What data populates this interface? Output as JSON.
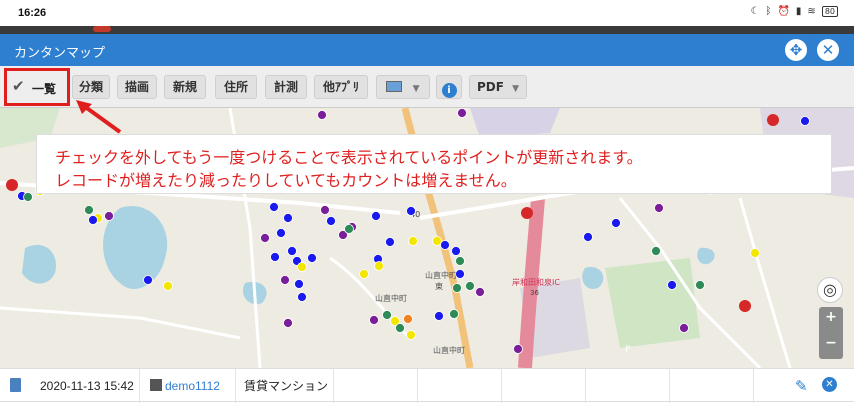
{
  "status_bar": {
    "time": "16:26",
    "battery": "80"
  },
  "dialog": {
    "title": "カンタンマップ"
  },
  "toolbar": {
    "list_label": "一覧",
    "buttons": [
      {
        "id": "category",
        "label": "分類"
      },
      {
        "id": "draw",
        "label": "描画"
      },
      {
        "id": "new",
        "label": "新規"
      },
      {
        "id": "address",
        "label": "住所"
      },
      {
        "id": "measure",
        "label": "計測"
      },
      {
        "id": "other_apps",
        "label": "他ｱﾌﾟﾘ"
      },
      {
        "id": "pdf",
        "label": "PDF"
      }
    ]
  },
  "callout": {
    "line1": "チェックを外してもう一度つけることで表示されているポイントが更新されます。",
    "line2": "レコードが増えたり減ったりしていてもカウントは増えません。",
    "color": "#e02020"
  },
  "map": {
    "labels": [
      "山直中町",
      "東",
      "山直中町",
      "山直中町",
      "岸和田和泉IC",
      "40",
      "36",
      "P"
    ],
    "point_colors": {
      "blue": "#1a1aee",
      "purple": "#7a1f9a",
      "yellow": "#f3e600",
      "green": "#2e8b57",
      "orange": "#f08020"
    }
  },
  "record": {
    "datetime": "2020-11-13 15:42",
    "user": "demo1112",
    "category": "賃貸マンション"
  },
  "colors": {
    "header": "#2f7fd0",
    "highlight": "#e01e1e"
  }
}
